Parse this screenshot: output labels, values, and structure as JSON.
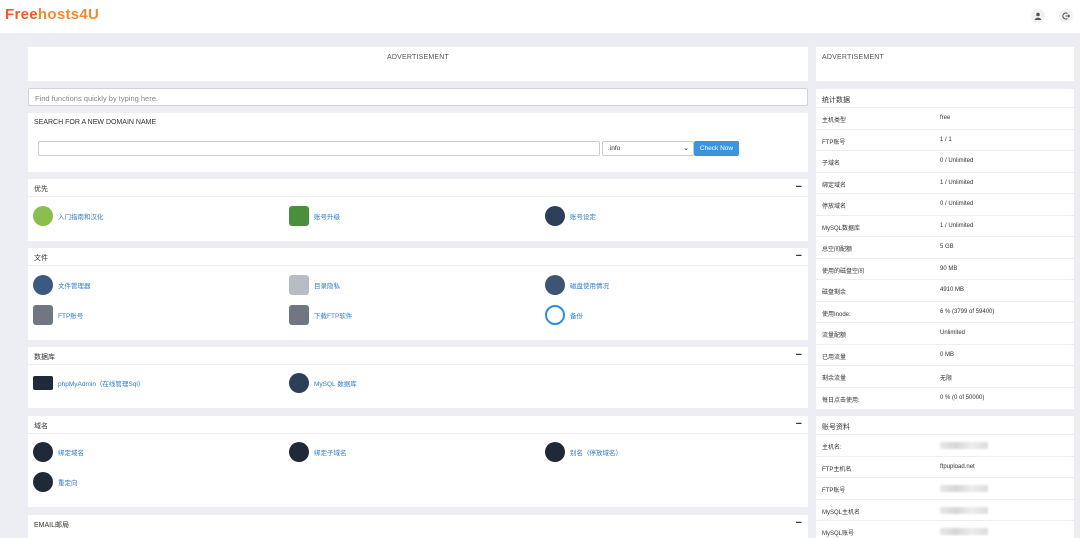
{
  "header": {
    "logo_part1": "Free",
    "logo_part2": "hosts4U",
    "user_icon": "user-icon",
    "logout_icon": "logout-icon"
  },
  "ads": {
    "left": "ADVERTISEMENT",
    "right": "ADVERTISEMENT"
  },
  "search": {
    "placeholder": "Find functions quickly by typing here."
  },
  "domain_search": {
    "title": "SEARCH FOR A NEW DOMAIN NAME",
    "input_value": "",
    "tld": ".info",
    "button": "Check Now"
  },
  "sections": {
    "priority": {
      "title": "优先",
      "items": [
        {
          "label": "入门指南和汉化",
          "icon": "getting-started-icon"
        },
        {
          "label": "账号升级",
          "icon": "upgrade-icon"
        },
        {
          "label": "账号设定",
          "icon": "account-settings-icon"
        }
      ]
    },
    "files": {
      "title": "文件",
      "items": [
        {
          "label": "文件管理器",
          "icon": "file-manager-icon"
        },
        {
          "label": "目录隐私",
          "icon": "directory-privacy-icon"
        },
        {
          "label": "磁盘使用情况",
          "icon": "disk-usage-icon"
        },
        {
          "label": "FTP账号",
          "icon": "ftp-accounts-icon"
        },
        {
          "label": "下载FTP软件",
          "icon": "download-ftp-icon"
        },
        {
          "label": "备份",
          "icon": "backup-icon"
        }
      ]
    },
    "database": {
      "title": "数据库",
      "items": [
        {
          "label": "phpMyAdmin（在线管理Sql）",
          "icon": "phpmyadmin-icon"
        },
        {
          "label": "MySQL 数据库",
          "icon": "mysql-icon"
        }
      ]
    },
    "domains": {
      "title": "域名",
      "items": [
        {
          "label": "绑定域名",
          "icon": "addon-domain-icon"
        },
        {
          "label": "绑定子域名",
          "icon": "subdomain-icon"
        },
        {
          "label": "别名（停放域名）",
          "icon": "alias-icon"
        },
        {
          "label": "重定向",
          "icon": "redirect-icon"
        }
      ]
    },
    "email": {
      "title": "EMAIL邮局"
    }
  },
  "stats": {
    "title": "统计数据",
    "rows": [
      {
        "k": "主机类型",
        "v": "free"
      },
      {
        "k": "FTP账号",
        "v": "1 / 1"
      },
      {
        "k": "子域名",
        "v": "0 / Unlimited"
      },
      {
        "k": "绑定域名",
        "v": "1 / Unlimited"
      },
      {
        "k": "停放域名",
        "v": "0 / Unlimited"
      },
      {
        "k": "MySQL数据库",
        "v": "1 / Unlimited"
      },
      {
        "k": "总空间配额",
        "v": "5 GB"
      },
      {
        "k": "使用的磁盘空间",
        "v": "90 MB"
      },
      {
        "k": "磁盘剩余",
        "v": "4910 MB"
      },
      {
        "k": "使用Inode:",
        "v": "6 % (3799 of 59400)"
      },
      {
        "k": "流量配额",
        "v": "Unlimited"
      },
      {
        "k": "已用流量",
        "v": "0 MB"
      },
      {
        "k": "剩余流量",
        "v": "无限"
      },
      {
        "k": "每日点击使用:",
        "v": "0 % (0 of 50000)"
      }
    ]
  },
  "account": {
    "title": "账号资料",
    "rows": [
      {
        "k": "主机名:",
        "v": ""
      },
      {
        "k": "FTP主机名",
        "v": "ftpupload.net"
      },
      {
        "k": "FTP账号",
        "v": ""
      },
      {
        "k": "MySQL主机名",
        "v": ""
      },
      {
        "k": "MySQL账号",
        "v": ""
      }
    ]
  }
}
